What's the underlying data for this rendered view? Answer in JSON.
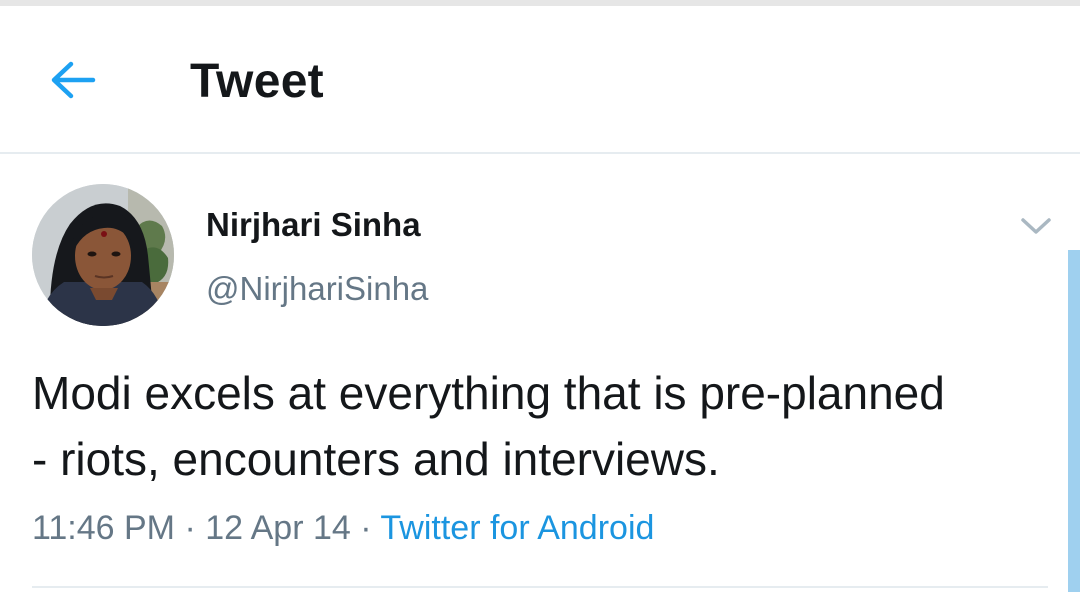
{
  "header": {
    "title": "Tweet",
    "back_icon": "arrow-left-icon",
    "accent_color": "#1da1f2"
  },
  "tweet": {
    "author": {
      "name": "Nirjhari Sinha",
      "handle": "@NirjhariSinha",
      "avatar": "avatar-photo"
    },
    "more_icon": "chevron-down-icon",
    "text": "Modi excels at everything that is pre-planned\n- riots, encounters and interviews.",
    "meta": {
      "time": "11:46 PM",
      "separator": " · ",
      "date": "12 Apr 14",
      "source": "Twitter for Android"
    }
  },
  "colors": {
    "text_primary": "#14171a",
    "text_secondary": "#657786",
    "link": "#1b95e0",
    "divider": "#e6ecf0"
  }
}
